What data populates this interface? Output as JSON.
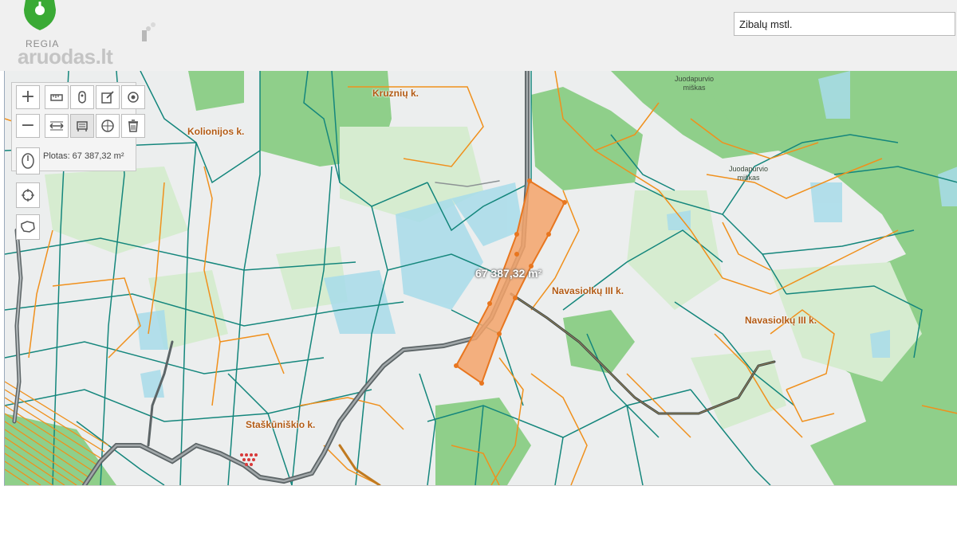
{
  "logo": {
    "brand_top": "REGIA",
    "brand_main": "aruodas",
    "brand_tld": ".lt"
  },
  "search": {
    "value": "Zibalų mstl."
  },
  "toolbar": {
    "zoom_in": "+",
    "zoom_out": "−",
    "area_readout": "Plotas: 67 387,32 m²"
  },
  "map": {
    "selected_area_label": "67 387,32 m²",
    "village_labels": [
      "Kruznių k.",
      "Kolionijos k.",
      "Navasiolkų III k.",
      "Navasiolkų III k.",
      "Staškūniškio k."
    ],
    "forest_labels": [
      [
        "Juodapurvio",
        "miškas"
      ],
      [
        "Juodapurvio",
        "miškas"
      ]
    ]
  },
  "colors": {
    "forest": "#8fcf8a",
    "light_green": "#d6ecd0",
    "water": "#a8dcea",
    "parcel_teal": "#14867c",
    "parcel_orange": "#f0901c",
    "selected_fill": "#f4a36a",
    "selected_stroke": "#e8761f",
    "road": "#5c6466",
    "label": "#b25a14",
    "logo_green": "#3aaa35"
  }
}
